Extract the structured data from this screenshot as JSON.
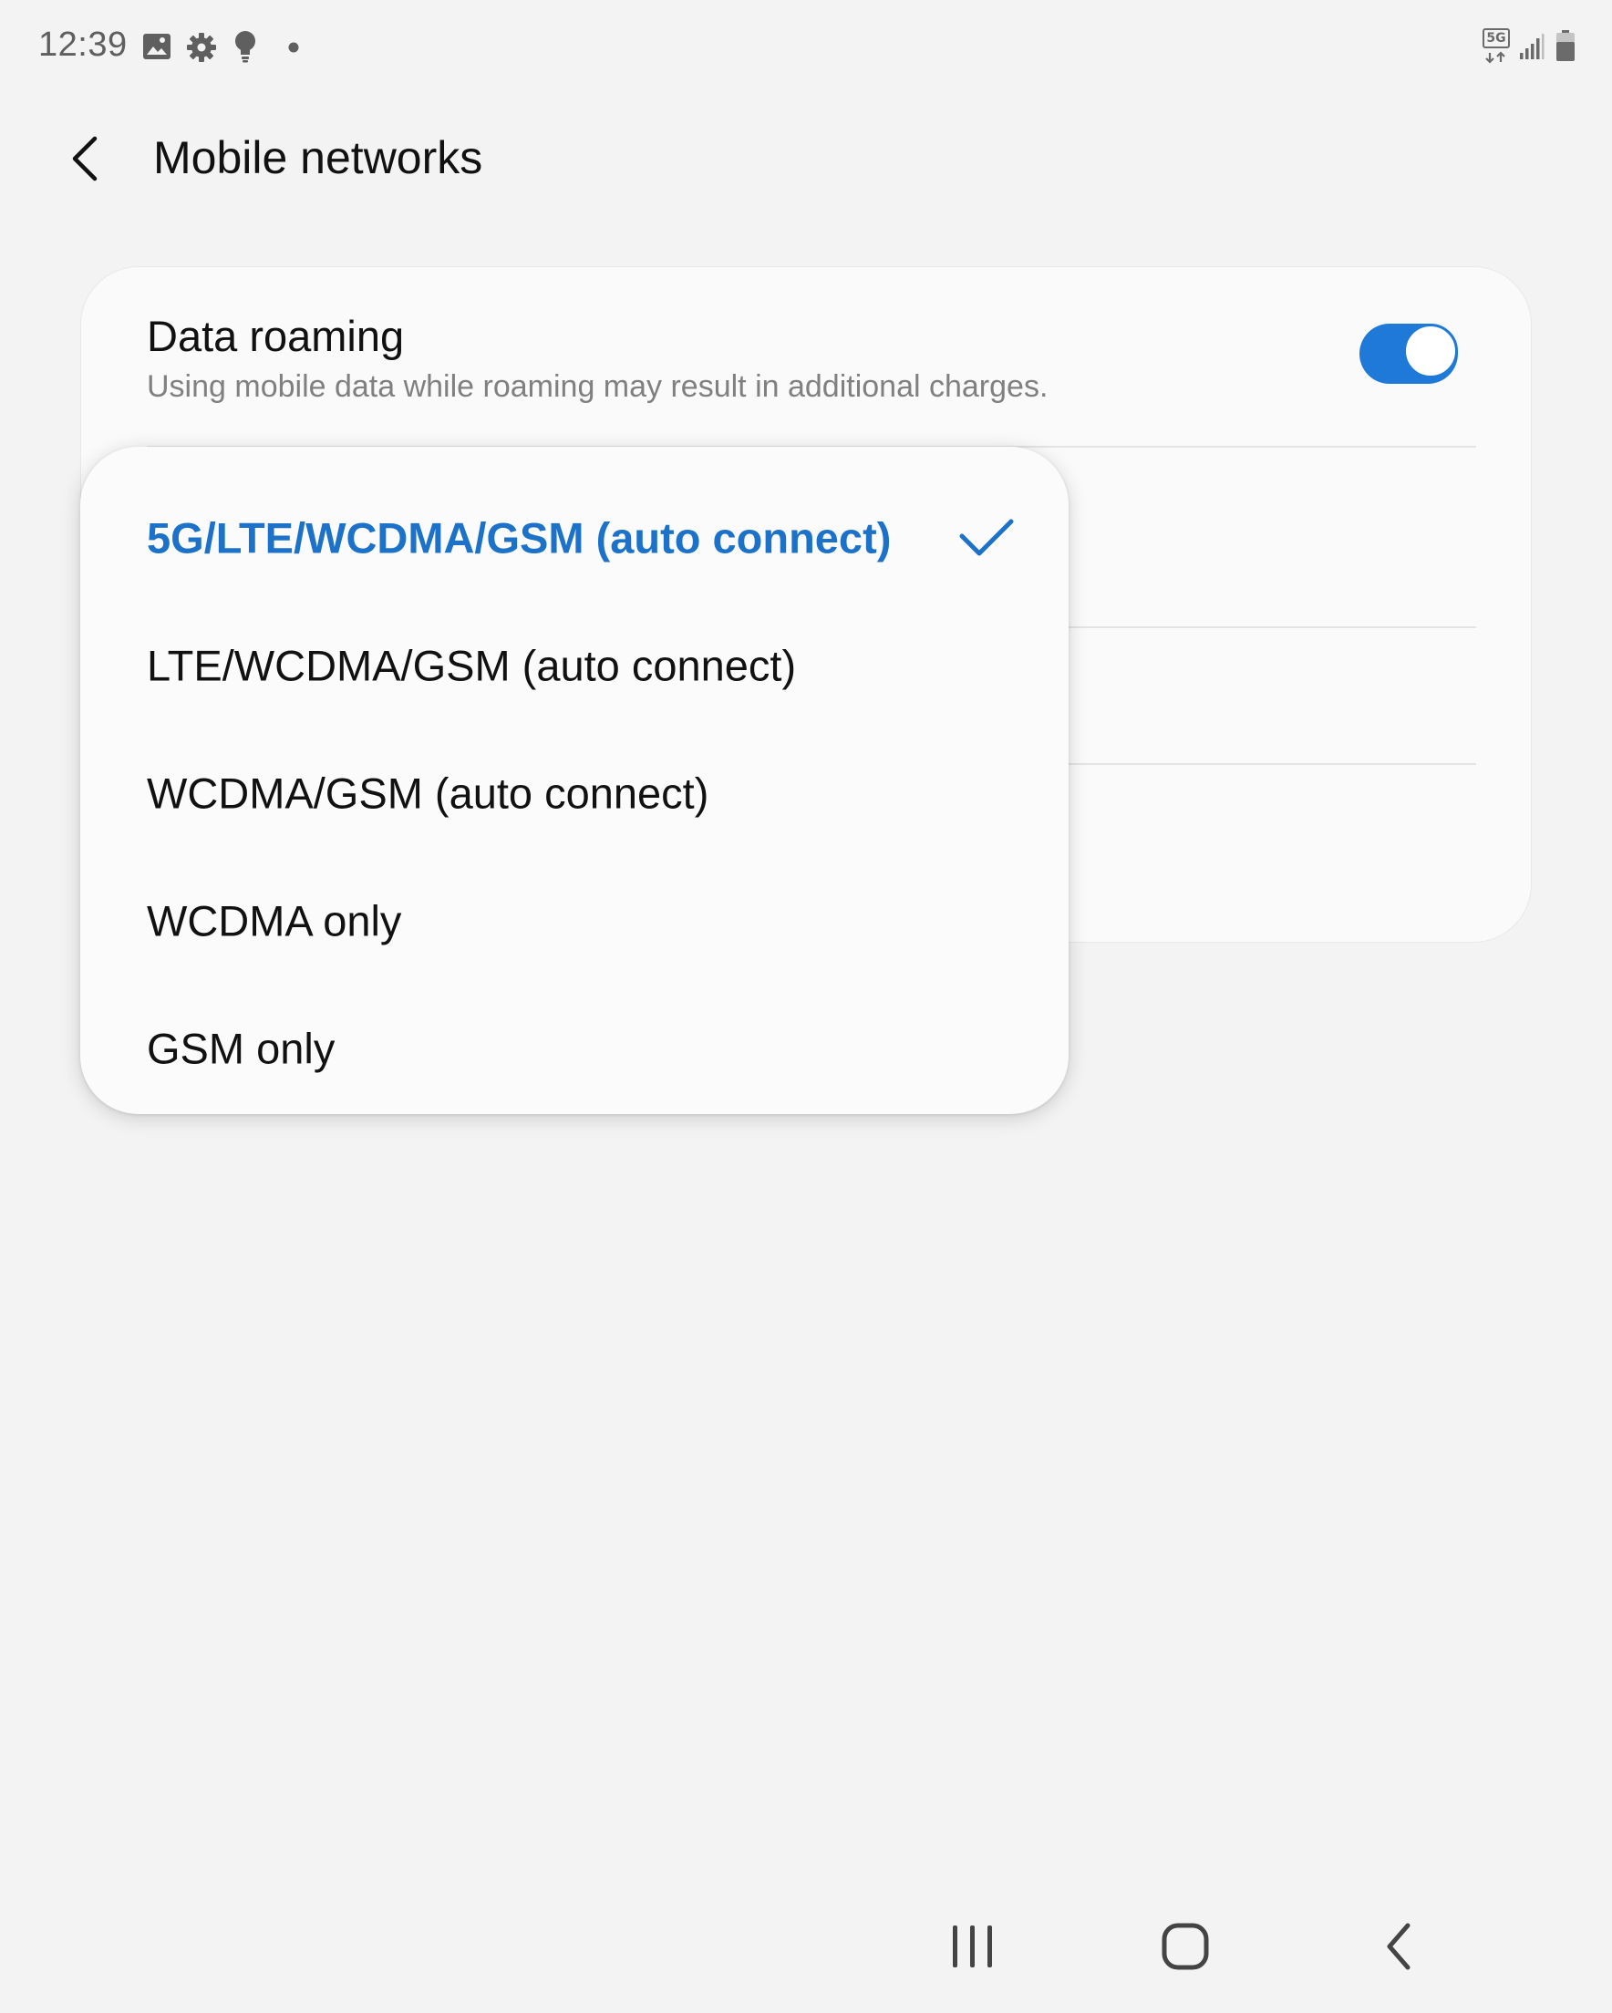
{
  "status_bar": {
    "time": "12:39",
    "left_icons": [
      "gallery-icon",
      "settings-gear-icon",
      "bulb-icon",
      "notification-dot-icon"
    ],
    "network_badge": "5G",
    "right_icons": [
      "5g-data-icon",
      "signal-icon",
      "battery-icon"
    ]
  },
  "header": {
    "title": "Mobile networks",
    "back_icon": "back-arrow-icon"
  },
  "settings": {
    "data_roaming": {
      "title": "Data roaming",
      "summary": "Using mobile data while roaming may result in additional charges.",
      "enabled": true
    }
  },
  "network_mode_popup": {
    "selected_index": 0,
    "options": [
      {
        "label": "5G/LTE/WCDMA/GSM (auto connect)"
      },
      {
        "label": "LTE/WCDMA/GSM (auto connect)"
      },
      {
        "label": "WCDMA/GSM (auto connect)"
      },
      {
        "label": "WCDMA only"
      },
      {
        "label": "GSM only"
      }
    ]
  },
  "nav_bar": {
    "buttons": [
      "recent-apps-icon",
      "home-icon",
      "back-icon"
    ]
  },
  "colors": {
    "background": "#f3f3f3",
    "card": "#fafafa",
    "accent": "#1f79d8",
    "selected_text": "#1b72c8",
    "secondary_text": "#808080"
  }
}
